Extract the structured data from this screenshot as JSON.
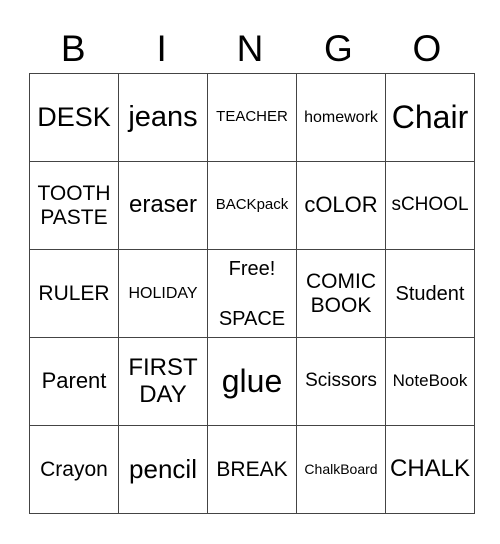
{
  "header": {
    "letters": [
      "B",
      "I",
      "N",
      "G",
      "O"
    ]
  },
  "grid": {
    "rows": [
      [
        "DESK",
        "jeans",
        "TEACHER",
        "homework",
        "Chair"
      ],
      [
        "TOOTH\nPASTE",
        "eraser",
        "BACKpack",
        "cOLOR",
        "sCHOOL"
      ],
      [
        "RULER",
        "HOLIDAY",
        "Free!|SPACE",
        "COMIC\nBOOK",
        "Student"
      ],
      [
        "Parent",
        "FIRST\nDAY",
        "glue",
        "Scissors",
        "NoteBook"
      ],
      [
        "Crayon",
        "pencil",
        "BREAK",
        "ChalkBoard",
        "CHALK"
      ]
    ],
    "free_space": {
      "label": "Free!",
      "value": "SPACE"
    }
  }
}
